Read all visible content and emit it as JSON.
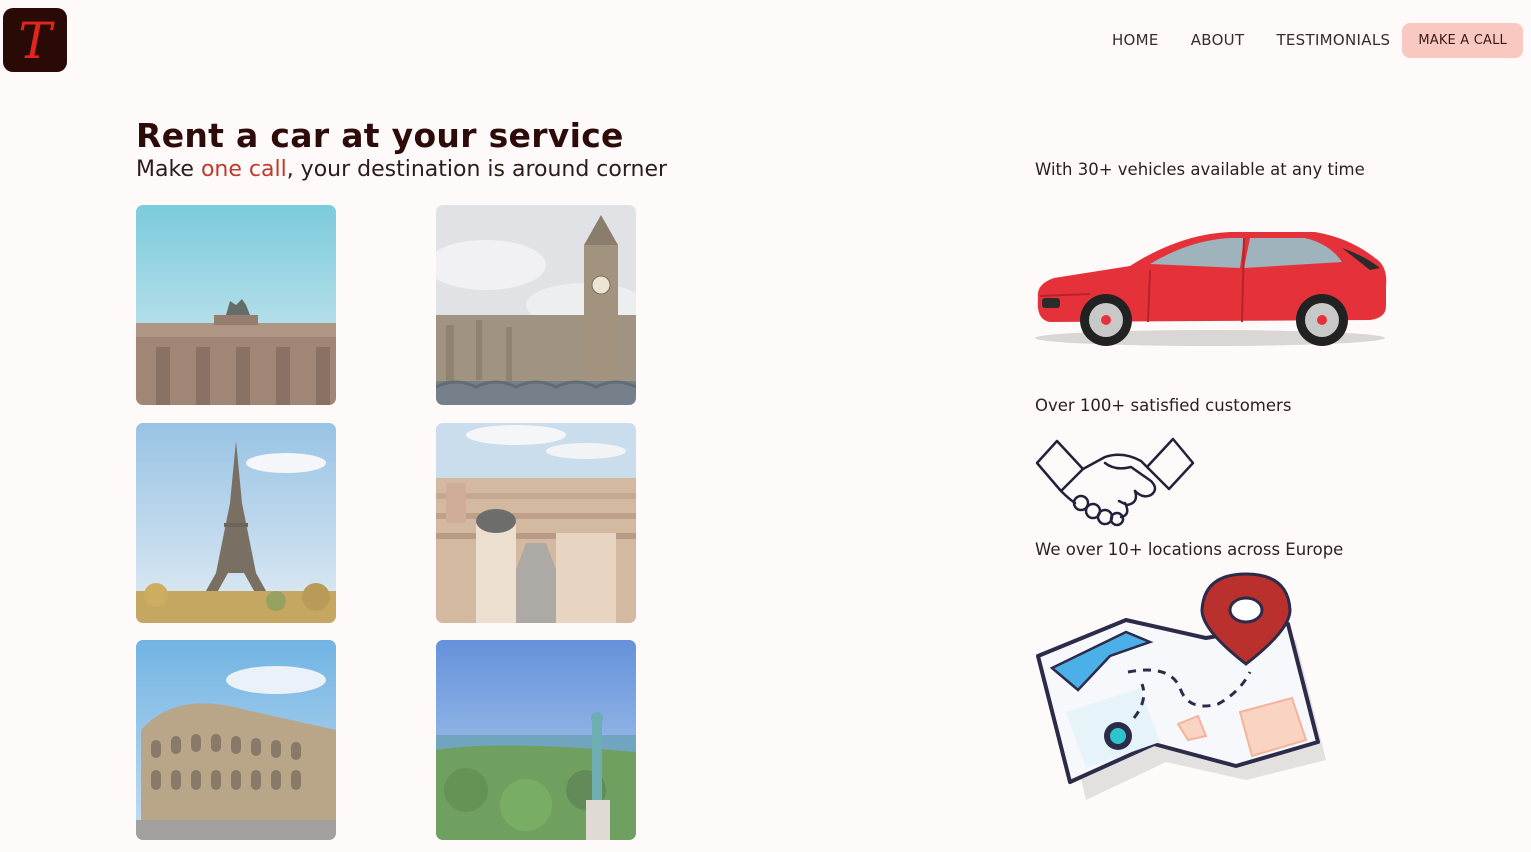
{
  "brand": {
    "logo_letter": "T"
  },
  "nav": {
    "items": [
      {
        "label": "HOME"
      },
      {
        "label": "ABOUT"
      },
      {
        "label": "TESTIMONIALS"
      }
    ],
    "cta_label": "MAKE A CALL"
  },
  "hero": {
    "title": "Rent a car at your service",
    "subtitle_before": "Make ",
    "subtitle_accent": "one call",
    "subtitle_after": ", your destination is around corner"
  },
  "features": [
    {
      "text": "With 30+ vehicles available at any time",
      "icon": "car-icon"
    },
    {
      "text": "Over 100+ satisfied customers",
      "icon": "handshake-icon"
    },
    {
      "text": "We over 10+ locations across Europe",
      "icon": "map-icon"
    }
  ],
  "colors": {
    "accent": "#c0392b",
    "cta_bg": "#f9c8c0",
    "logo_bg": "#2a0a07",
    "logo_fg": "#e0261d",
    "car_red": "#e5323a"
  }
}
